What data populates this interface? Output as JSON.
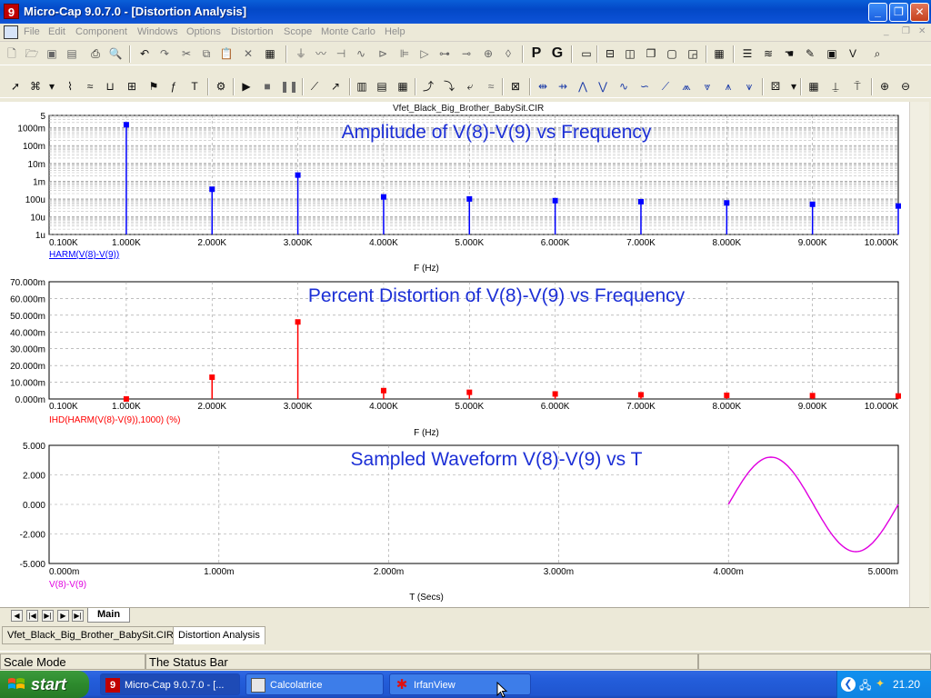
{
  "window": {
    "title": "Micro-Cap 9.0.7.0 - [Distortion Analysis]",
    "app_icon_glyph": "9"
  },
  "menu": [
    "File",
    "Edit",
    "Component",
    "Windows",
    "Options",
    "Distortion",
    "Scope",
    "Monte Carlo",
    "Help"
  ],
  "toolbar_letters": {
    "p": "P",
    "g": "G"
  },
  "circuit_file": "Vfet_Black_Big_Brother_BabySit.CIR",
  "colors": {
    "blue_trace": "#0000ff",
    "red_trace": "#ff0000",
    "magenta_trace": "#e000e0",
    "title_blue": "#1c2fd6"
  },
  "chart_data": [
    {
      "type": "bar",
      "title": "Amplitude of V(8)-V(9) vs Frequency",
      "xlabel": "F (Hz)",
      "ylabel": "",
      "series": [
        {
          "name": "HARM(V(8)-V(9))",
          "values": [
            1.5,
            0.00035,
            0.0022,
            0.00013,
            0.0001,
            8e-05,
            7e-05,
            6e-05,
            5e-05,
            4e-05
          ]
        }
      ],
      "x": [
        1000,
        2000,
        3000,
        4000,
        5000,
        6000,
        7000,
        8000,
        9000,
        10000
      ],
      "xlim": [
        100,
        10000
      ],
      "ylim": [
        1e-06,
        5
      ],
      "y_scale": "log",
      "x_ticks": [
        "0.100K",
        "1.000K",
        "2.000K",
        "3.000K",
        "4.000K",
        "5.000K",
        "6.000K",
        "7.000K",
        "8.000K",
        "9.000K",
        "10.000K"
      ],
      "y_ticks": [
        "5",
        "1000m",
        "100m",
        "10m",
        "1m",
        "100u",
        "10u",
        "1u"
      ],
      "grid": true
    },
    {
      "type": "bar",
      "title": "Percent Distortion of V(8)-V(9) vs Frequency",
      "xlabel": "F (Hz)",
      "ylabel": "",
      "series": [
        {
          "name": "IHD(HARM(V(8)-V(9)),1000) (%)",
          "values": [
            0,
            13,
            46,
            5,
            4,
            3,
            2.5,
            2.2,
            2,
            1.8
          ]
        }
      ],
      "x": [
        1000,
        2000,
        3000,
        4000,
        5000,
        6000,
        7000,
        8000,
        9000,
        10000
      ],
      "xlim": [
        100,
        10000
      ],
      "ylim": [
        0,
        70
      ],
      "x_ticks": [
        "0.100K",
        "1.000K",
        "2.000K",
        "3.000K",
        "4.000K",
        "5.000K",
        "6.000K",
        "7.000K",
        "8.000K",
        "9.000K",
        "10.000K"
      ],
      "y_ticks": [
        "70.000m",
        "60.000m",
        "50.000m",
        "40.000m",
        "30.000m",
        "20.000m",
        "10.000m",
        "0.000m"
      ],
      "grid": true
    },
    {
      "type": "line",
      "title": "Sampled Waveform  V(8)-V(9) vs T",
      "xlabel": "T (Secs)",
      "ylabel": "",
      "series": [
        {
          "name": "V(8)-V(9)",
          "x": [
            4.0,
            4.25,
            4.5,
            4.75,
            5.0
          ],
          "values": [
            0,
            4,
            0,
            -4,
            0
          ]
        }
      ],
      "xlim": [
        0,
        5
      ],
      "ylim": [
        -5,
        5
      ],
      "x_ticks": [
        "0.000m",
        "1.000m",
        "2.000m",
        "3.000m",
        "4.000m",
        "5.000m"
      ],
      "y_ticks": [
        "5.000",
        "2.000",
        "0.000",
        "-2.000",
        "-5.000"
      ],
      "grid": true
    }
  ],
  "bottom_tabs": {
    "main": "Main"
  },
  "doc_tabs": [
    "Vfet_Black_Big_Brother_BabySit.CIR",
    "Distortion Analysis"
  ],
  "status": {
    "mode": "Scale Mode",
    "message": "The Status Bar"
  },
  "taskbar": {
    "start_label": "start",
    "tasks": [
      "Micro-Cap 9.0.7.0 - [...",
      "Calcolatrice",
      "IrfanView"
    ],
    "clock": "21.20"
  }
}
